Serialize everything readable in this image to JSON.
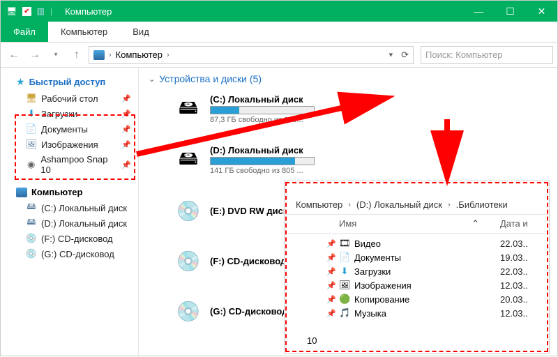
{
  "window": {
    "title": "Компьютер"
  },
  "ribbon": {
    "file": "Файл",
    "computer": "Компьютер",
    "view": "Вид"
  },
  "breadcrumb": {
    "item": "Компьютер"
  },
  "search": {
    "placeholder": "Поиск: Компьютер"
  },
  "sidebar": {
    "quick": "Быстрый доступ",
    "quick_items": [
      {
        "label": "Рабочий стол"
      },
      {
        "label": "Загрузки"
      },
      {
        "label": "Документы"
      },
      {
        "label": "Изображения"
      },
      {
        "label": "Ashampoo Snap 10"
      }
    ],
    "computer": "Компьютер",
    "comp_items": [
      {
        "label": "(C:) Локальный диск"
      },
      {
        "label": "(D:) Локальный диск"
      },
      {
        "label": "(F:) CD-дисковод"
      },
      {
        "label": "(G:) CD-дисковод"
      }
    ]
  },
  "content": {
    "group": "Устройства и диски (5)",
    "devices": [
      {
        "name": "(C:) Локальный диск",
        "sub": "87,3 ГБ свободно из 120...",
        "fill": 28,
        "icon": "hdd"
      },
      {
        "name": "(D:) Локальный диск",
        "sub": "141 ГБ свободно из 805 ...",
        "fill": 82,
        "icon": "hdd"
      },
      {
        "name": "(E:) DVD RW дисковод",
        "sub": "",
        "fill": 0,
        "icon": "dvd"
      },
      {
        "name": "(F:) CD-дисковод",
        "sub": "",
        "fill": 0,
        "icon": "cd"
      },
      {
        "name": "(G:) CD-дисковод",
        "sub": "",
        "fill": 0,
        "icon": "cd"
      }
    ]
  },
  "popup": {
    "bc": [
      "Компьютер",
      "(D:) Локальный диск",
      ".Библиотеки"
    ],
    "col_name": "Имя",
    "col_date": "Дата и",
    "count": "10",
    "rows": [
      {
        "icon": "🎞",
        "name": "Видео",
        "date": "22.03.."
      },
      {
        "icon": "📄",
        "name": "Документы",
        "date": "19.03.."
      },
      {
        "icon": "⬇",
        "name": "Загрузки",
        "date": "22.03.."
      },
      {
        "icon": "🖼",
        "name": "Изображения",
        "date": "12.03.."
      },
      {
        "icon": "🟢",
        "name": "Копирование",
        "date": "20.03.."
      },
      {
        "icon": "🎵",
        "name": "Музыка",
        "date": "12.03.."
      }
    ]
  }
}
